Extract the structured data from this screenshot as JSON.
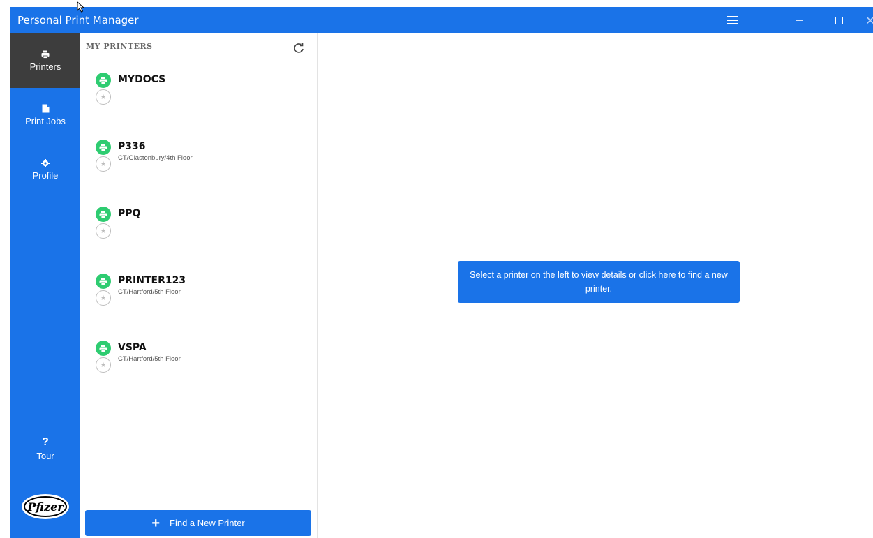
{
  "window": {
    "title": "Personal Print Manager"
  },
  "titlebar": {
    "menu_icon": "hamburger-icon",
    "minimize_icon": "minimize-icon",
    "maximize_icon": "maximize-icon",
    "close_icon": "close-icon",
    "close_glyph": "✕"
  },
  "nav": {
    "items": [
      {
        "label": "Printers",
        "icon": "printer-icon",
        "active": true
      },
      {
        "label": "Print Jobs",
        "icon": "document-icon",
        "active": false
      },
      {
        "label": "Profile",
        "icon": "gear-icon",
        "active": false
      }
    ],
    "tour": {
      "label": "Tour",
      "glyph": "?"
    },
    "logo_text": "Pfizer"
  },
  "printers_panel": {
    "heading": "MY PRINTERS",
    "refresh_icon": "refresh-icon",
    "printers": [
      {
        "name": "MYDOCS",
        "location": ""
      },
      {
        "name": "P336",
        "location": "CT/Glastonbury/4th Floor"
      },
      {
        "name": "PPQ",
        "location": ""
      },
      {
        "name": "PRINTER123",
        "location": "CT/Hartford/5th Floor"
      },
      {
        "name": "VSPA",
        "location": "CT/Hartford/5th Floor"
      }
    ],
    "find_button": {
      "label": "Find a New Printer",
      "icon": "plus-icon"
    }
  },
  "main": {
    "message": "Select a printer on the left to view details or click here to find a new printer."
  },
  "colors": {
    "accent": "#1a73e8",
    "nav_active": "#3d3d3d",
    "printer_ok": "#2ecc71"
  }
}
